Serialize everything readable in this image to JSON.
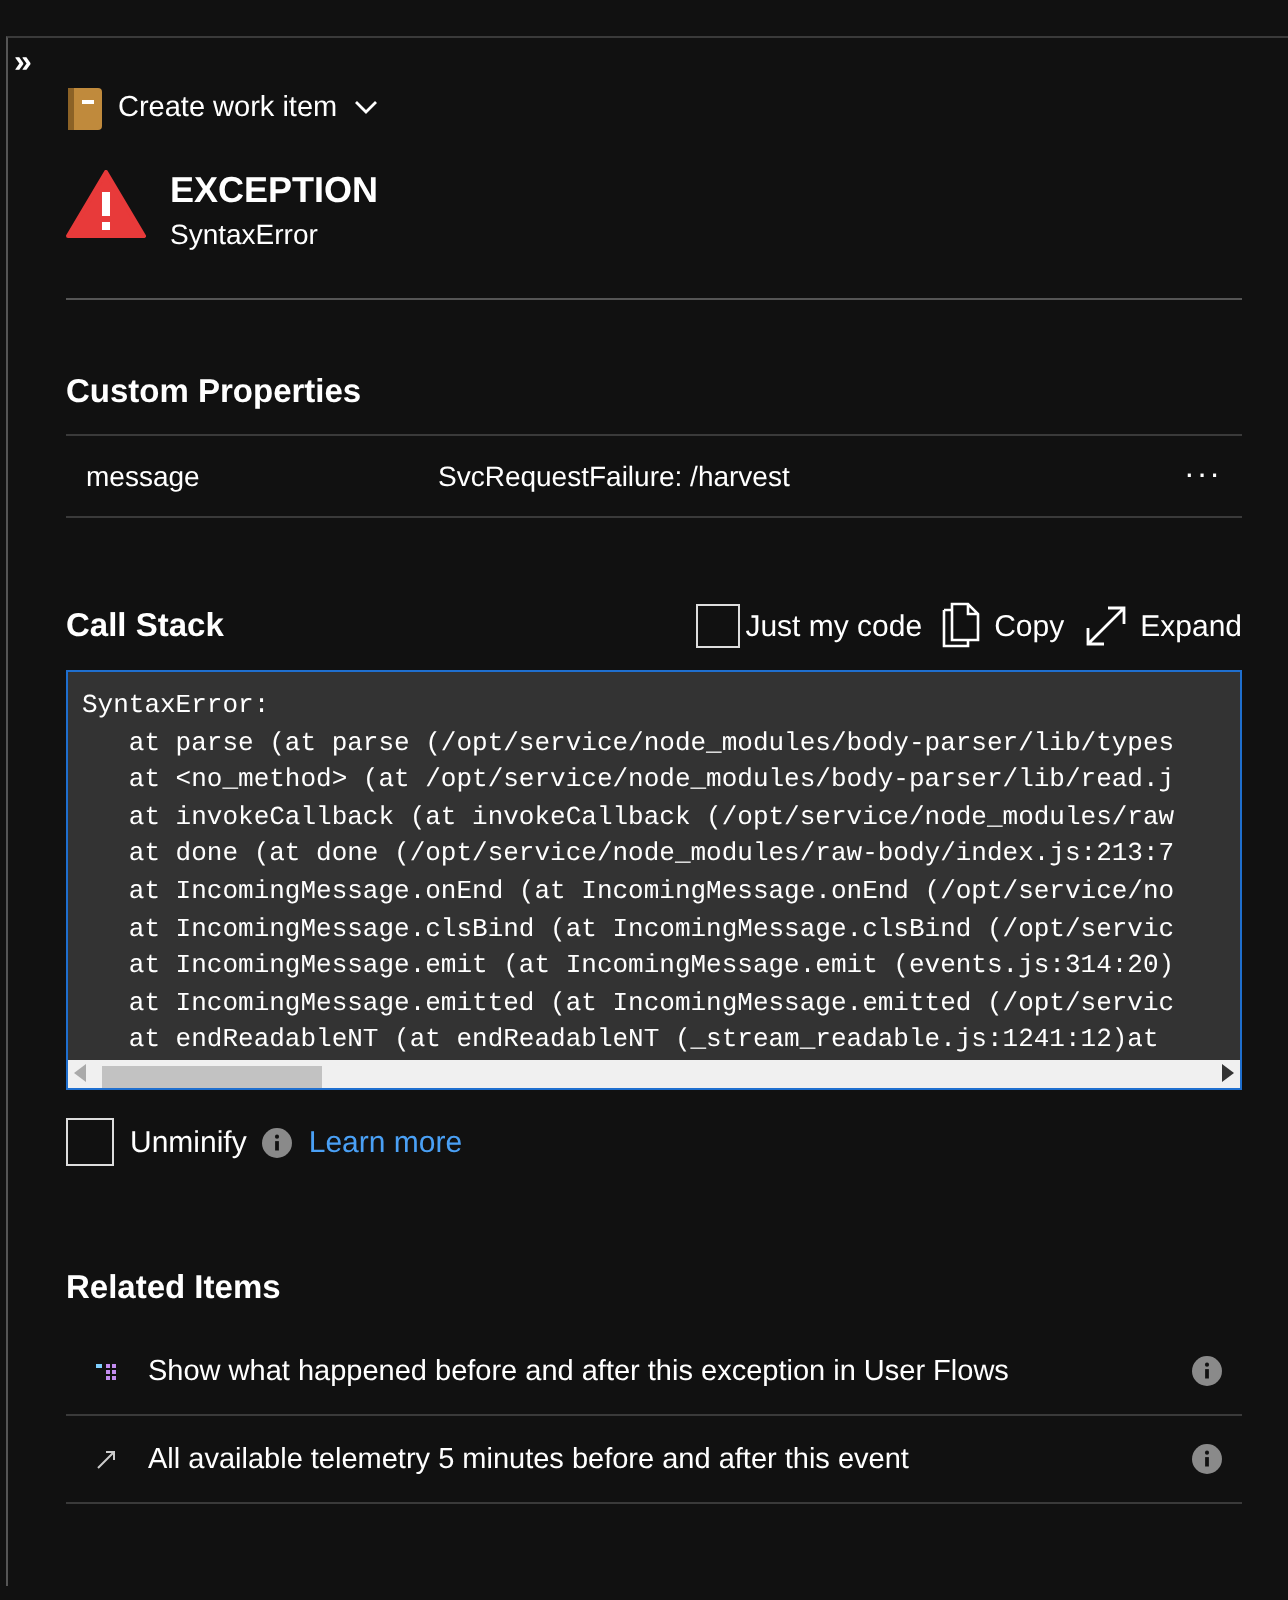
{
  "toolbar": {
    "collapse": "»",
    "create_label": "Create work item"
  },
  "header": {
    "title": "EXCEPTION",
    "subtitle": "SyntaxError"
  },
  "custom_properties": {
    "title": "Custom Properties",
    "rows": [
      {
        "key": "message",
        "value": "SvcRequestFailure: /harvest",
        "more": "···"
      }
    ]
  },
  "call_stack": {
    "title": "Call Stack",
    "just_my_code": {
      "label": "Just my code",
      "checked": false
    },
    "copy": "Copy",
    "expand": "Expand",
    "lines": [
      "SyntaxError:",
      "   at parse (at parse (/opt/service/node_modules/body-parser/lib/types",
      "   at <no_method> (at /opt/service/node_modules/body-parser/lib/read.j",
      "   at invokeCallback (at invokeCallback (/opt/service/node_modules/raw",
      "   at done (at done (/opt/service/node_modules/raw-body/index.js:213:7",
      "   at IncomingMessage.onEnd (at IncomingMessage.onEnd (/opt/service/no",
      "   at IncomingMessage.clsBind (at IncomingMessage.clsBind (/opt/servic",
      "   at IncomingMessage.emit (at IncomingMessage.emit (events.js:314:20)",
      "   at IncomingMessage.emitted (at IncomingMessage.emitted (/opt/servic",
      "   at endReadableNT (at endReadableNT (_stream_readable.js:1241:12)at"
    ],
    "unminify": {
      "label": "Unminify",
      "checked": false
    },
    "learn_more": "Learn more"
  },
  "related": {
    "title": "Related Items",
    "items": [
      {
        "kind": "flows",
        "text": "Show what happened before and after this exception in User Flows"
      },
      {
        "kind": "telemetry",
        "text": "All available telemetry 5 minutes before and after this event"
      }
    ]
  }
}
